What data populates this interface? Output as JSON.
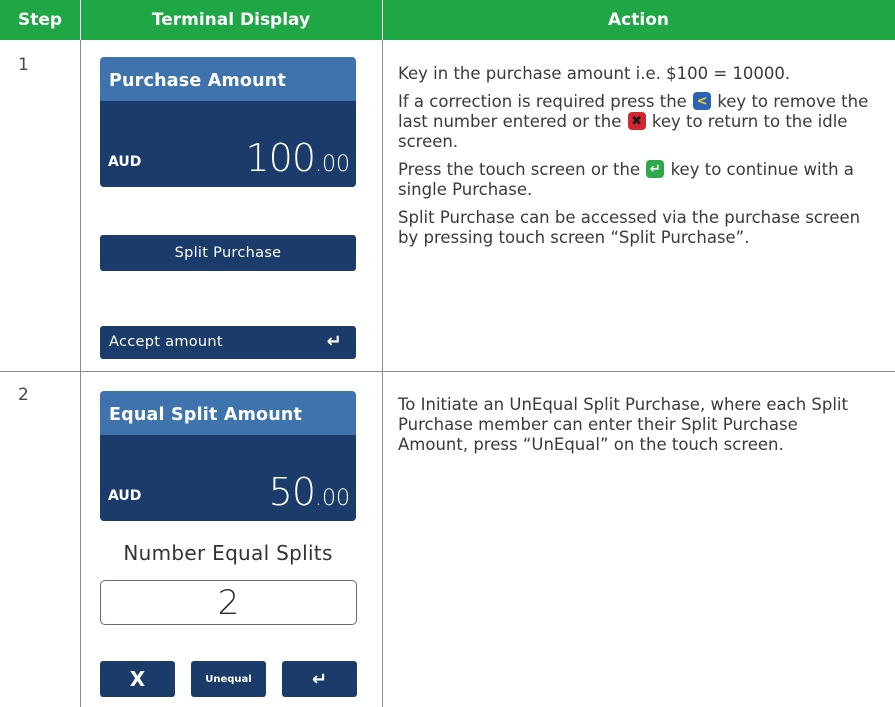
{
  "header": {
    "step": "Step",
    "terminal_display": "Terminal Display",
    "action": "Action"
  },
  "colors": {
    "header_green": "#1fa645",
    "screen_blue": "#3f73ad",
    "screen_navy": "#1b3c6b",
    "key_yellow": "#f3d21a",
    "key_red": "#d22730",
    "key_green": "#2ea84a"
  },
  "rows": [
    {
      "step": "1",
      "screen": {
        "title": "Purchase Amount",
        "currency": "AUD",
        "amount_main": "100",
        "amount_cents": ".00"
      },
      "split_button": "Split Purchase",
      "accept_button": "Accept amount",
      "accept_icon": "enter-icon",
      "action": {
        "p1": "Key in the purchase amount i.e. $100 = 10000.",
        "p2_a": "If a correction is required press the",
        "p2_key1": "back-key-icon",
        "p2_b": "key to remove the last number entered or the",
        "p2_key2": "cancel-key-icon",
        "p2_c": "key to return to the idle screen.",
        "p3_a": "Press the touch screen or the",
        "p3_key": "enter-key-icon",
        "p3_b": "key to continue with a single Purchase.",
        "p4": "Split Purchase can be accessed via the purchase screen by pressing touch screen “Split Purchase”."
      }
    },
    {
      "step": "2",
      "screen": {
        "title": "Equal Split Amount",
        "currency": "AUD",
        "amount_main": "50",
        "amount_cents": ".00"
      },
      "number_label": "Number Equal Splits",
      "number_value": "2",
      "buttons": {
        "cancel": "X",
        "unequal": "Unequal",
        "enter_icon": "enter-icon"
      },
      "action": {
        "p1": "To Initiate an UnEqual Split Purchase, where each Split Purchase member can enter their Split Purchase Amount, press “UnEqual” on the touch screen."
      }
    }
  ]
}
